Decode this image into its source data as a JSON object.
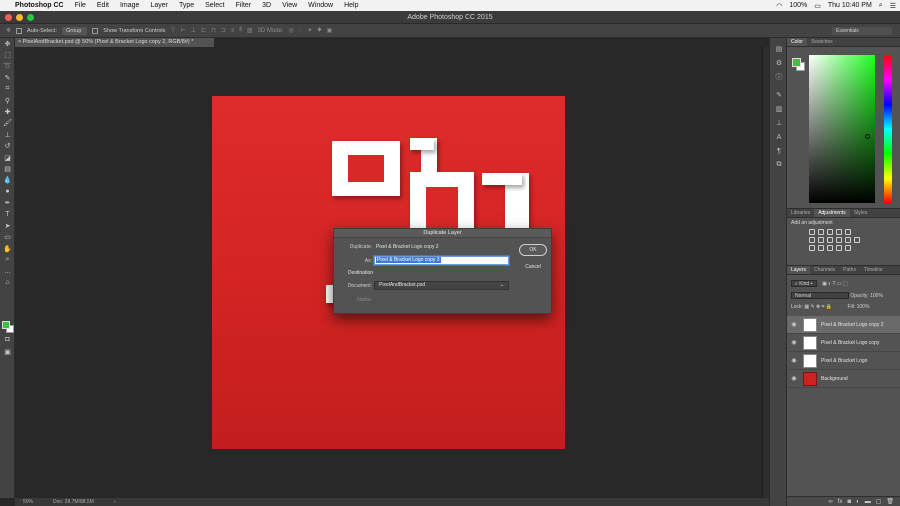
{
  "mac_menu": {
    "apple": "",
    "app": "Photoshop CC",
    "items": [
      "File",
      "Edit",
      "Image",
      "Layer",
      "Type",
      "Select",
      "Filter",
      "3D",
      "View",
      "Window",
      "Help"
    ],
    "battery": "100%",
    "clock": "Thu 10:40 PM"
  },
  "window": {
    "title": "Adobe Photoshop CC 2015"
  },
  "options_bar": {
    "auto_select_label": "Auto-Select:",
    "auto_select_value": "Group",
    "transform_label": "Show Transform Controls",
    "mode_3d": "3D Mode:",
    "workspace": "Essentials"
  },
  "document": {
    "tab_title": "PixelAndBracket.psd @ 50% (Pixel & Bracket Logo copy 2, RGB/8#) *"
  },
  "status": {
    "zoom": "50%",
    "doc_size": "Doc: 28.7M/88.5M"
  },
  "colors": {
    "foreground": "#3fbf44",
    "background": "#ffffff",
    "canvas_red": "#d62525"
  },
  "panels": {
    "color_tabs": [
      "Color",
      "Swatches"
    ],
    "adjust_tabs": [
      "Libraries",
      "Adjustments",
      "Styles"
    ],
    "adjust_subtitle": "Add an adjustment",
    "layers_tabs": [
      "Layers",
      "Channels",
      "Paths",
      "Timeline"
    ],
    "kind_filter": "Kind",
    "blend_mode": "Normal",
    "opacity_label": "Opacity:",
    "opacity_value": "100%",
    "lock_label": "Lock:",
    "fill_label": "Fill:",
    "fill_value": "100%"
  },
  "layers": [
    {
      "name": "Pixel & Bracket Logo copy 2",
      "selected": true,
      "thumb": "#ffffff"
    },
    {
      "name": "Pixel & Bracket Logo copy",
      "selected": false,
      "thumb": "#ffffff"
    },
    {
      "name": "Pixel & Bracket Logo",
      "selected": false,
      "thumb": "#ffffff"
    },
    {
      "name": "Background",
      "selected": false,
      "thumb": "#cc2222"
    }
  ],
  "dialog": {
    "title": "Duplicate Layer",
    "duplicate_label": "Duplicate:",
    "duplicate_value": "Pixel & Bracket Logo copy 2",
    "as_label": "As:",
    "as_value": "Pixel & Bracket Logo copy 3",
    "destination_label": "Destination",
    "document_label": "Document:",
    "document_value": "PixelAndBracket.psd",
    "name_label": "Name:",
    "ok_label": "OK",
    "cancel_label": "Cancel"
  }
}
